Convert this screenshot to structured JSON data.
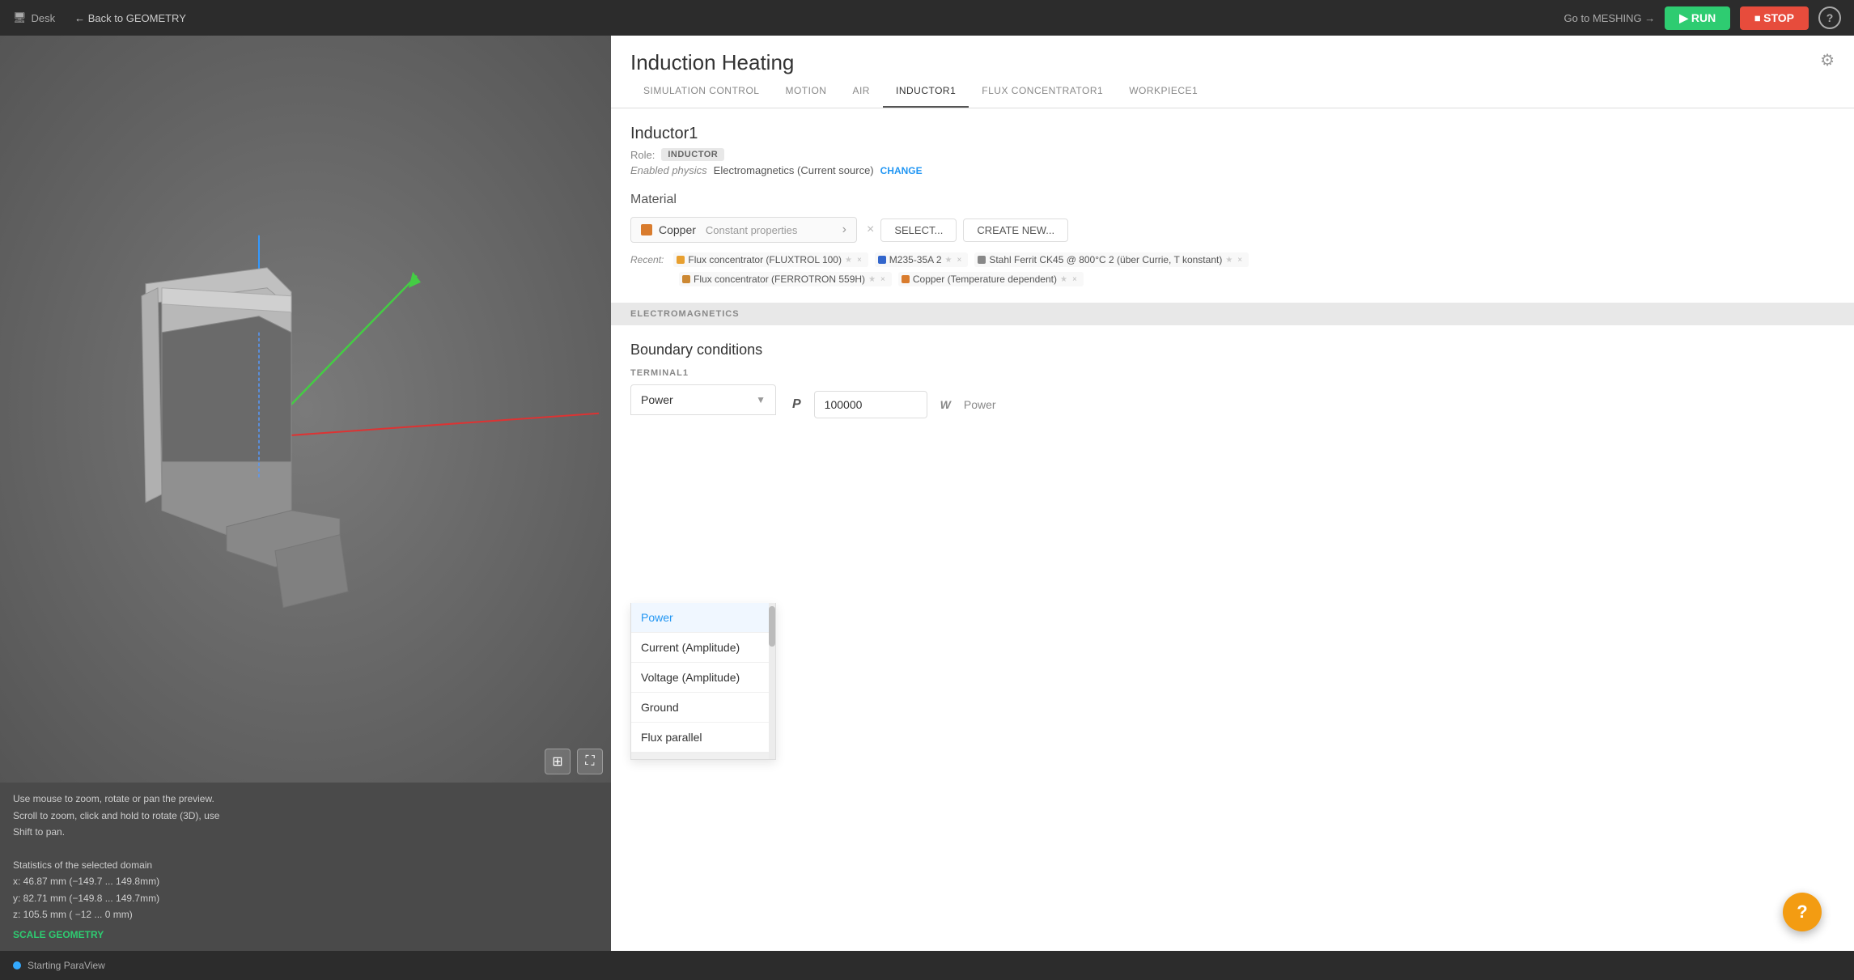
{
  "topbar": {
    "desk_label": "Desk",
    "back_label": "← Back to GEOMETRY",
    "go_meshing_label": "Go to MESHING →",
    "run_label": "▶ RUN",
    "stop_label": "⏹ STOP",
    "help_label": "?"
  },
  "app": {
    "title": "Induction Heating",
    "settings_icon": "⚙"
  },
  "tabs": [
    {
      "id": "simulation-control",
      "label": "SIMULATION CONTROL",
      "active": false
    },
    {
      "id": "motion",
      "label": "MOTION",
      "active": false
    },
    {
      "id": "air",
      "label": "AIR",
      "active": false
    },
    {
      "id": "inductor1",
      "label": "INDUCTOR1",
      "active": true
    },
    {
      "id": "flux-concentrator1",
      "label": "FLUX CONCENTRATOR1",
      "active": false
    },
    {
      "id": "workpiece1",
      "label": "WORKPIECE1",
      "active": false
    }
  ],
  "inductor": {
    "title": "Inductor1",
    "role_label": "Role:",
    "role_badge": "INDUCTOR",
    "enabled_physics_label": "Enabled physics",
    "enabled_physics_value": "Electromagnetics (Current source)",
    "change_label": "CHANGE"
  },
  "material": {
    "section_title": "Material",
    "color": "#d97c2e",
    "name": "Copper",
    "props": "Constant properties",
    "expand_icon": "›",
    "close_icon": "×",
    "select_label": "SELECT...",
    "create_label": "CREATE NEW...",
    "recent_label": "Recent:",
    "recent_items": [
      {
        "label": "Flux concentrator (FLUXTROL 100)",
        "color": "#e8a030",
        "has_star": true
      },
      {
        "label": "M235-35A 2",
        "color": "#3366cc",
        "has_star": true
      },
      {
        "label": "Stahl Ferrit CK45 @ 800°C 2 (über Currie, T konstant)",
        "color": "#888",
        "has_star": true
      },
      {
        "label": "Flux concentrator (FERROTRON 559H)",
        "color": "#cc8833",
        "has_star": true
      },
      {
        "label": "Copper (Temperature dependent)",
        "color": "#d97c2e",
        "has_star": true
      }
    ]
  },
  "electromagnetics": {
    "section_label": "ELECTROMAGNETICS"
  },
  "boundary_conditions": {
    "title": "Boundary conditions",
    "terminal_label": "TERMINAL1",
    "selected_option": "Power",
    "dropdown_options": [
      {
        "label": "Power",
        "selected": true
      },
      {
        "label": "Current (Amplitude)",
        "selected": false
      },
      {
        "label": "Voltage (Amplitude)",
        "selected": false
      },
      {
        "label": "Ground",
        "selected": false
      },
      {
        "label": "Flux parallel",
        "selected": false
      }
    ],
    "power_icon": "P",
    "power_value": "100000",
    "power_unit": "W",
    "power_type": "Power"
  },
  "viewport": {
    "info_line1": "Use mouse to zoom, rotate or pan the preview.",
    "info_line2": "Scroll to zoom, click and hold to rotate (3D), use",
    "info_line3": "Shift to pan.",
    "stats_title": "Statistics of the selected domain",
    "stats_x": "x:  46.87 mm  (−149.7 ... 149.8mm)",
    "stats_y": "y:  82.71 mm  (−149.8 ... 149.7mm)",
    "stats_z": "z: 105.5 mm  (   −12 ... 0     mm)",
    "scale_label": "SCALE GEOMETRY"
  },
  "statusbar": {
    "label": "Starting ParaView"
  },
  "colors": {
    "run_green": "#2ecc71",
    "stop_red": "#e74c3c",
    "active_tab_border": "#444",
    "help_orange": "#f39c12"
  }
}
